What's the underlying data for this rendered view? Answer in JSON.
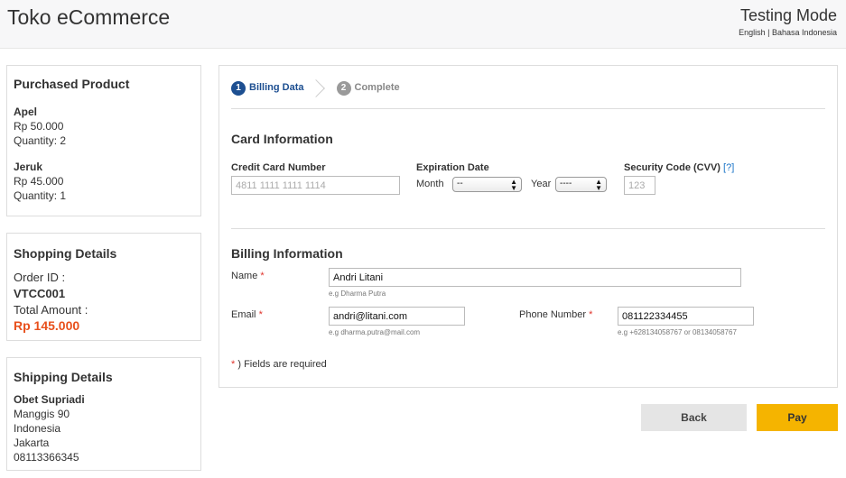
{
  "header": {
    "brand": "Toko eCommerce",
    "mode": "Testing Mode",
    "lang_en": "English",
    "lang_sep": " | ",
    "lang_id": "Bahasa Indonesia"
  },
  "purchased": {
    "title": "Purchased Product",
    "items": [
      {
        "name": "Apel",
        "price": "Rp 50.000",
        "quantity": "Quantity: 2"
      },
      {
        "name": "Jeruk",
        "price": "Rp 45.000",
        "quantity": "Quantity: 1"
      }
    ]
  },
  "shopping": {
    "title": "Shopping Details",
    "order_label": "Order ID :",
    "order_id": "VTCC001",
    "total_label": "Total Amount :",
    "total": "Rp 145.000"
  },
  "shipping": {
    "title": "Shipping Details",
    "name": "Obet Supriadi",
    "address": "Manggis 90",
    "country": "Indonesia",
    "city": "Jakarta",
    "phone": "08113366345"
  },
  "steps": [
    {
      "num": "1",
      "label": "Billing Data"
    },
    {
      "num": "2",
      "label": "Complete"
    }
  ],
  "card": {
    "title": "Card Information",
    "number_label": "Credit Card Number",
    "number_placeholder": "4811 1111 1111 1114",
    "exp_label": "Expiration Date",
    "month_label": "Month",
    "month_value": "--",
    "year_label": "Year",
    "year_value": "----",
    "cvv_label": "Security Code (CVV)",
    "cvv_help": "[?]",
    "cvv_placeholder": "123"
  },
  "billing": {
    "title": "Billing Information",
    "name_label": "Name",
    "name_value": "Andri Litani",
    "name_hint": "e.g Dharma Putra",
    "email_label": "Email",
    "email_value": "andri@litani.com",
    "email_hint": "e.g dharma.putra@mail.com",
    "phone_label": "Phone Number",
    "phone_value": "081122334455",
    "phone_hint": "e.g +628134058767 or 08134058767",
    "required_mark": "*",
    "required_note": ") Fields are required"
  },
  "buttons": {
    "back": "Back",
    "pay": "Pay"
  },
  "colors": {
    "step_active": "#1d4f91",
    "total": "#e8501c",
    "pay": "#f5b400",
    "back": "#e5e5e5"
  }
}
